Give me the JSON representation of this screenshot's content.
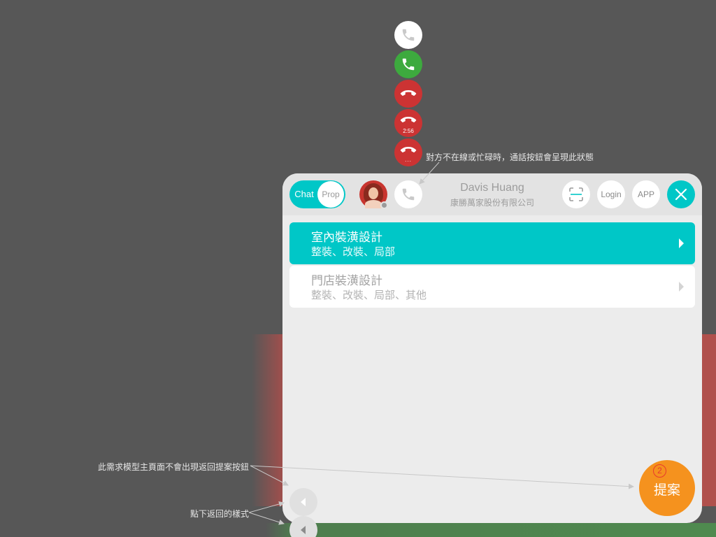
{
  "call_states": [
    {
      "state": "idle",
      "color": "#ffffff",
      "icon": "phone-icon"
    },
    {
      "state": "available",
      "color": "#3daa3e",
      "icon": "phone-icon"
    },
    {
      "state": "hangup",
      "color": "#cc3333",
      "icon": "hangup-icon"
    },
    {
      "state": "in-call",
      "color": "#cc3333",
      "icon": "hangup-icon",
      "timer": "2:56"
    },
    {
      "state": "connecting",
      "color": "#cc3333",
      "icon": "hangup-icon",
      "dots": "..."
    }
  ],
  "annotations": {
    "busy_note": "對方不在線或忙碌時，通話按鈕會呈現此狀態",
    "no_back_note": "此需求模型主頁面不會出現返回提案按鈕",
    "pressed_note": "點下返回的樣式"
  },
  "header": {
    "toggle": {
      "left_label": "Chat",
      "right_label": "Prop"
    },
    "contact": {
      "name": "Davis Huang",
      "company": "康勝萬家股份有限公司"
    },
    "buttons": {
      "scan_icon": "scan-icon",
      "login_label": "Login",
      "app_label": "APP",
      "close_icon": "close-icon"
    }
  },
  "items": [
    {
      "title": "室內裝潢設計",
      "subtitle": "整裝、改裝、局部",
      "selected": true
    },
    {
      "title": "門店裝潢設計",
      "subtitle": "整裝、改裝、局部、其他",
      "selected": false
    }
  ],
  "fab": {
    "label": "提案",
    "badge": "2"
  },
  "colors": {
    "accent": "#00c7c7",
    "fab": "#f5921e",
    "red": "#cc3333",
    "green": "#3daa3e"
  }
}
